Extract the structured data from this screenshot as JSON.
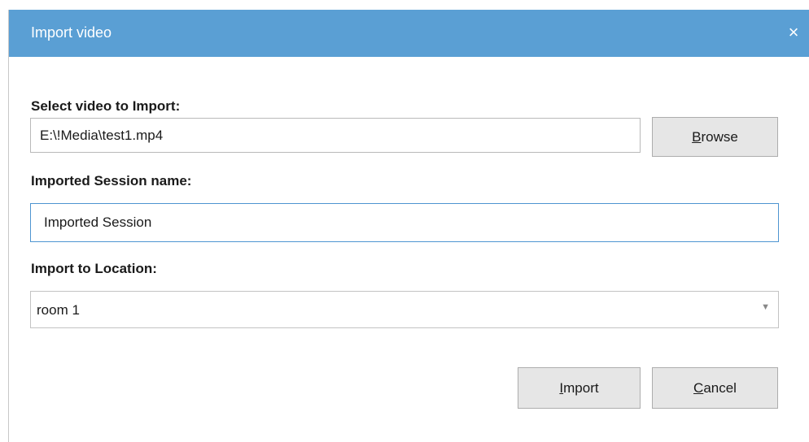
{
  "dialog": {
    "title": "Import video",
    "close_label": "×"
  },
  "video": {
    "label": "Select video to Import:",
    "path_value": "E:\\!Media\\test1.mp4",
    "browse_mnemonic": "B",
    "browse_rest": "rowse"
  },
  "session": {
    "label": "Imported Session name:",
    "name_value": "Imported Session"
  },
  "location": {
    "label": "Import to Location:",
    "selected": "room 1",
    "arrow": "▼"
  },
  "actions": {
    "import_mnemonic": "I",
    "import_rest": "mport",
    "cancel_mnemonic": "C",
    "cancel_rest": "ancel"
  },
  "colors": {
    "titlebar": "#5a9fd4",
    "focus_border": "#4e95d1"
  }
}
